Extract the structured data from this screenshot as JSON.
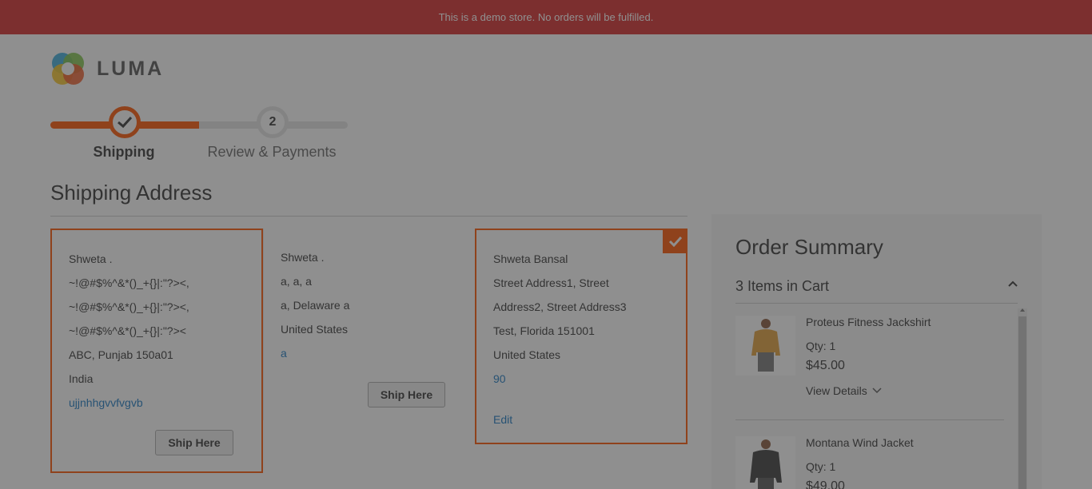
{
  "notice": {
    "text": "This is a demo store. No orders will be fulfilled.",
    "color": "#d42a2a"
  },
  "logo": {
    "text": "LUMA",
    "icon": "luma-logo-icon"
  },
  "progress": {
    "steps": [
      {
        "label": "Shipping",
        "state": "complete",
        "icon": "check-icon"
      },
      {
        "number": "2",
        "label": "Review & Payments",
        "state": "pending"
      }
    ],
    "accent": "#ff5501"
  },
  "shipping": {
    "title": "Shipping Address",
    "addresses": [
      {
        "lines": [
          "Shweta .",
          "~!@#$%^&*()_+{}|:\"?><,",
          "~!@#$%^&*()_+{}|:\"?><,",
          "~!@#$%^&*()_+{}|:\"?><",
          "ABC, Punjab 150a01",
          "India"
        ],
        "phone": "ujjnhhgvvfvgvb",
        "button": "Ship Here",
        "selected": false,
        "highlighted": true
      },
      {
        "lines": [
          "Shweta .",
          "a, a, a",
          "a, Delaware a",
          "United States"
        ],
        "phone": "a",
        "button": "Ship Here",
        "selected": false,
        "highlighted": false
      },
      {
        "lines": [
          "Shweta Bansal",
          "Street Address1, Street",
          "Address2, Street Address3",
          "Test, Florida 151001",
          "United States"
        ],
        "phone": "90",
        "edit": "Edit",
        "selected": true,
        "highlighted": true
      }
    ]
  },
  "summary": {
    "title": "Order Summary",
    "items_in_cart": "3 Items in Cart",
    "items": [
      {
        "name": "Proteus Fitness Jackshirt",
        "qty": "Qty: 1",
        "price": "$45.00",
        "details": "View Details",
        "icon": "jackshirt-product-icon"
      },
      {
        "name": "Montana Wind Jacket",
        "qty": "Qty: 1",
        "price": "$49.00",
        "icon": "wind-jacket-product-icon"
      }
    ]
  },
  "overlay": {
    "state": "modal-loading-mask"
  }
}
